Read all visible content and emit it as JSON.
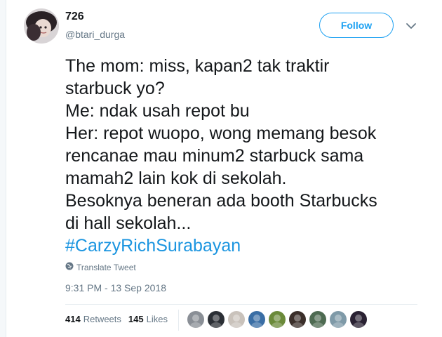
{
  "tweet": {
    "display_name": "726",
    "handle": "@btari_durga",
    "follow_label": "Follow",
    "lines": [
      "The mom: miss, kapan2 tak traktir",
      "starbuck yo?",
      "Me: ndak usah repot bu",
      "Her: repot wuopo, wong memang besok",
      "rencanae mau minum2 starbuck sama",
      "mamah2 lain kok di sekolah.",
      "Besoknya beneran ada booth Starbucks",
      "di hall sekolah..."
    ],
    "hashtag": "#CarzyRichSurabayan",
    "translate_label": "Translate Tweet",
    "timestamp": "9:31 PM - 13 Sep 2018"
  },
  "stats": {
    "retweets_count": "414",
    "retweets_label": "Retweets",
    "likes_count": "145",
    "likes_label": "Likes"
  },
  "icons": {
    "translate": "globe-icon",
    "caret": "chevron-down-icon"
  },
  "colors": {
    "accent": "#1da1f2",
    "hashtag": "#1b95e0",
    "muted": "#657786",
    "text": "#14171a"
  },
  "likers": [
    {
      "name": "liker-avatar-1",
      "color": "#8a8f96"
    },
    {
      "name": "liker-avatar-2",
      "color": "#2b2f35"
    },
    {
      "name": "liker-avatar-3",
      "color": "#c9c2bb"
    },
    {
      "name": "liker-avatar-4",
      "color": "#3a6ea5"
    },
    {
      "name": "liker-avatar-5",
      "color": "#6b8a3a"
    },
    {
      "name": "liker-avatar-6",
      "color": "#3b2f2a"
    },
    {
      "name": "liker-avatar-7",
      "color": "#4e6b52"
    },
    {
      "name": "liker-avatar-8",
      "color": "#7f9aa8"
    },
    {
      "name": "liker-avatar-9",
      "color": "#2a2233"
    }
  ]
}
